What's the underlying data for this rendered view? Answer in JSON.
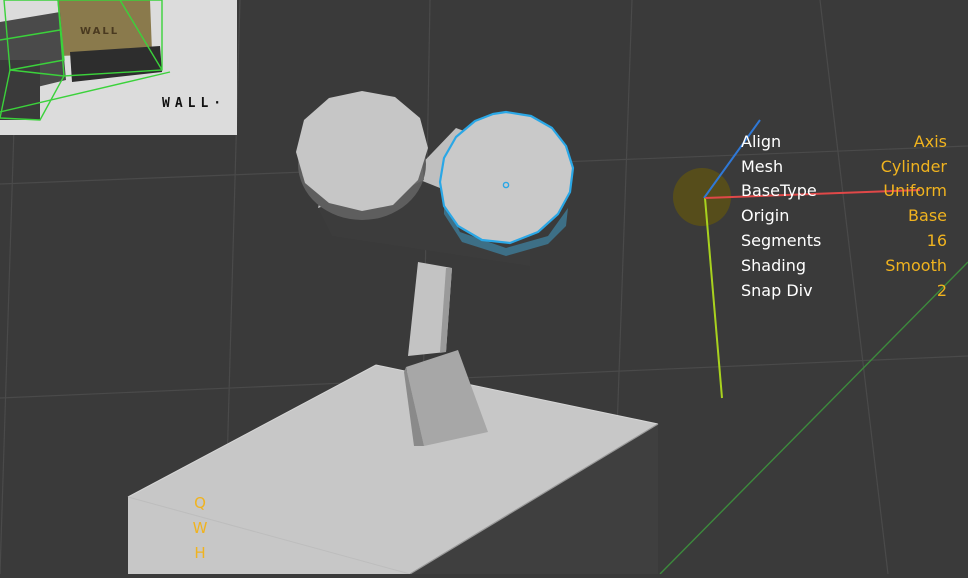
{
  "reference_image": {
    "caption": "WALL·",
    "robot_label": "WALL"
  },
  "operator_panel": {
    "rows": [
      {
        "label": "Align",
        "value": "Axis"
      },
      {
        "label": "Mesh",
        "value": "Cylinder"
      },
      {
        "label": "BaseType",
        "value": "Uniform"
      },
      {
        "label": "Origin",
        "value": "Base"
      },
      {
        "label": "Segments",
        "value": "16"
      },
      {
        "label": "Shading",
        "value": "Smooth"
      },
      {
        "label": "Snap Div",
        "value": "2"
      }
    ]
  },
  "hotkeys": [
    "Q",
    "W",
    "H"
  ],
  "colors": {
    "background": "#3a3a3a",
    "grid": "#4a4a4a",
    "label": "#ffffff",
    "value": "#f0b31f",
    "selection": "#2aa7e6",
    "axis_x": "#e04848",
    "axis_y": "#a8d21e",
    "axis_z": "#2f78d6",
    "floor_axis": "#3c8a3c"
  }
}
